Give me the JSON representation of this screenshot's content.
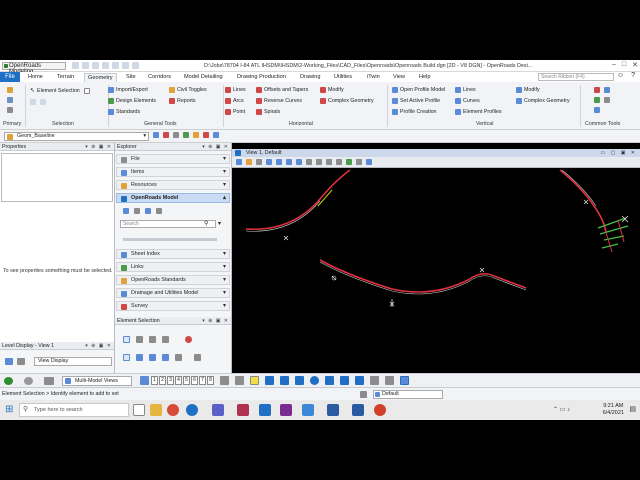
{
  "titlebar": {
    "workspace": "OpenRoads Modeling",
    "path": "D:\\Jobs\\78704 I-84 ATL IHSDM\\IHSDM\\2-Working_Files\\CAD_Files\\Openroads\\Openroads Build.dgn [2D - V8 DGN] - OpenRoads Desi..."
  },
  "ribbon_tabs": {
    "file": "File",
    "tabs": [
      "Home",
      "Terrain",
      "Geometry",
      "Site",
      "Corridors",
      "Model Detailing",
      "Drawing Production",
      "Drawing",
      "Utilities",
      "iTwin",
      "View",
      "Help"
    ],
    "active": "Geometry",
    "search_placeholder": "Search Ribbon (F4)"
  },
  "ribbon": {
    "primary_label": "Primary",
    "selection": {
      "element_selection": "Element Selection",
      "label": "Selection"
    },
    "general": {
      "import_export": "Import/Export",
      "design_elements": "Design Elements",
      "standards": "Standards",
      "civil_toggles": "Civil Toggles",
      "reports": "Reports",
      "label": "General Tools"
    },
    "horizontal": {
      "lines": "Lines",
      "arcs": "Arcs",
      "point": "Point",
      "offsets_tapers": "Offsets and Tapers",
      "reverse_curves": "Reverse Curves",
      "spirals": "Spirals",
      "modify": "Modify",
      "complex_geometry": "Complex Geometry",
      "label": "Horizontal"
    },
    "vertical": {
      "open_profile": "Open Profile Model",
      "set_active_profile": "Set Active Profile",
      "profile_creation": "Profile Creation",
      "lines": "Lines",
      "curves": "Curves",
      "element_profiles": "Element Profiles",
      "modify": "Modify",
      "complex_geometry": "Complex Geometry",
      "label": "Vertical"
    },
    "common_label": "Common Tools"
  },
  "toolbar": {
    "feature_def": "Geom_Baseline"
  },
  "properties": {
    "title": "Properties",
    "empty_message": "To see properties something must be selected."
  },
  "explorer": {
    "title": "Explorer",
    "items": [
      "File",
      "Items",
      "Resources",
      "OpenRoads Model"
    ],
    "search_placeholder": "Search",
    "sections": [
      "Sheet Index",
      "Links",
      "OpenRoads Standards",
      "Drainage and Utilities Model",
      "Survey"
    ]
  },
  "element_selection": {
    "title": "Element Selection"
  },
  "level_display": {
    "title": "Level Display - View 1",
    "view_display": "View Display"
  },
  "view": {
    "title": "View 1, Default"
  },
  "bottom_toolbar": {
    "multi_model": "Multi-Model Views",
    "view_numbers": [
      "1",
      "2",
      "3",
      "4",
      "5",
      "6",
      "7",
      "8"
    ]
  },
  "statusbar": {
    "prompt": "Element Selection > Identify element to add to set",
    "level": "Default"
  },
  "taskbar": {
    "search": "Type here to search",
    "time": "9:21 AM",
    "date": "6/4/2021"
  },
  "colors": {
    "accent": "#1f6fc5",
    "alignment": "#e03040",
    "canvas": "#000000"
  }
}
